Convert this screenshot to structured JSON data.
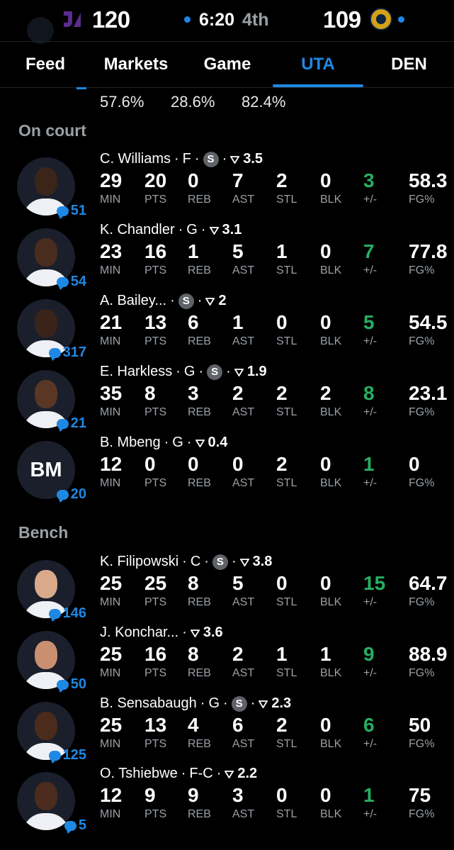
{
  "scoreboard": {
    "home_score": "120",
    "clock": "6:20",
    "period": "4th",
    "away_score": "109"
  },
  "tabs": [
    {
      "label": "Feed"
    },
    {
      "label": "Markets"
    },
    {
      "label": "Game"
    },
    {
      "label": "UTA"
    },
    {
      "label": "DEN"
    }
  ],
  "team_pcts": [
    "57.6%",
    "28.6%",
    "82.4%"
  ],
  "stat_labels": {
    "min": "MIN",
    "pts": "PTS",
    "reb": "REB",
    "ast": "AST",
    "stl": "STL",
    "blk": "BLK",
    "pm": "+/-",
    "fg": "FG%"
  },
  "sections": {
    "on_court": "On court",
    "bench": "Bench"
  },
  "on_court": [
    {
      "name": "C. Williams",
      "pos": "F",
      "starter": true,
      "proj": "3.5",
      "comments": "51",
      "min": "29",
      "pts": "20",
      "reb": "0",
      "ast": "7",
      "stl": "2",
      "blk": "0",
      "pm": "3",
      "fg": "58.3",
      "skin": "#3b2418"
    },
    {
      "name": "K. Chandler",
      "pos": "G",
      "starter": false,
      "proj": "3.1",
      "comments": "54",
      "min": "23",
      "pts": "16",
      "reb": "1",
      "ast": "5",
      "stl": "1",
      "blk": "0",
      "pm": "7",
      "fg": "77.8",
      "skin": "#4a2c1e"
    },
    {
      "name": "A. Bailey...",
      "pos": "",
      "starter": true,
      "proj": "2",
      "comments": "317",
      "min": "21",
      "pts": "13",
      "reb": "6",
      "ast": "1",
      "stl": "0",
      "blk": "0",
      "pm": "5",
      "fg": "54.5",
      "skin": "#3a2419"
    },
    {
      "name": "E. Harkless",
      "pos": "G",
      "starter": true,
      "proj": "1.9",
      "comments": "21",
      "min": "35",
      "pts": "8",
      "reb": "3",
      "ast": "2",
      "stl": "2",
      "blk": "2",
      "pm": "8",
      "fg": "23.1",
      "skin": "#5a3624"
    },
    {
      "name": "B. Mbeng",
      "pos": "G",
      "starter": false,
      "proj": "0.4",
      "comments": "20",
      "initials": "BM",
      "min": "12",
      "pts": "0",
      "reb": "0",
      "ast": "0",
      "stl": "2",
      "blk": "0",
      "pm": "1",
      "fg": "0",
      "skin": ""
    }
  ],
  "bench": [
    {
      "name": "K. Filipowski",
      "pos": "C",
      "starter": true,
      "proj": "3.8",
      "comments": "146",
      "min": "25",
      "pts": "25",
      "reb": "8",
      "ast": "5",
      "stl": "0",
      "blk": "0",
      "pm": "15",
      "fg": "64.7",
      "skin": "#d9a98a"
    },
    {
      "name": "J. Konchar...",
      "pos": "",
      "starter": false,
      "proj": "3.6",
      "comments": "50",
      "min": "25",
      "pts": "16",
      "reb": "8",
      "ast": "2",
      "stl": "1",
      "blk": "1",
      "pm": "9",
      "fg": "88.9",
      "skin": "#c98f70"
    },
    {
      "name": "B. Sensabaugh",
      "pos": "G",
      "starter": true,
      "proj": "2.3",
      "comments": "125",
      "min": "25",
      "pts": "13",
      "reb": "4",
      "ast": "6",
      "stl": "2",
      "blk": "0",
      "pm": "6",
      "fg": "50",
      "skin": "#4a2b1c"
    },
    {
      "name": "O. Tshiebwe",
      "pos": "F-C",
      "starter": false,
      "proj": "2.2",
      "comments": "5",
      "min": "12",
      "pts": "9",
      "reb": "9",
      "ast": "3",
      "stl": "0",
      "blk": "0",
      "pm": "1",
      "fg": "75",
      "skin": "#4b2c1d"
    }
  ]
}
